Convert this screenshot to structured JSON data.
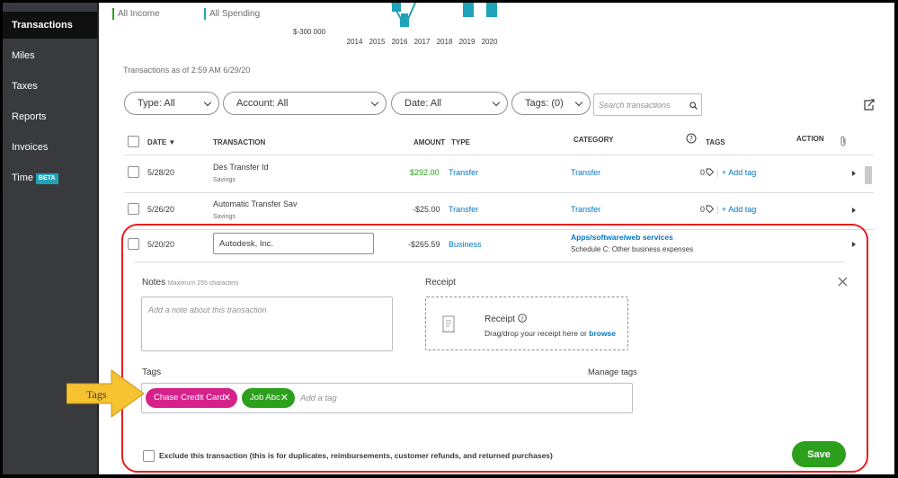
{
  "sidebar": {
    "items": [
      {
        "label": "Transactions"
      },
      {
        "label": "Miles"
      },
      {
        "label": "Taxes"
      },
      {
        "label": "Reports"
      },
      {
        "label": "Invoices"
      },
      {
        "label": "Time",
        "badge": "BETA"
      }
    ]
  },
  "chart": {
    "legend": [
      {
        "label": "All Income",
        "color": "#2ca01c"
      },
      {
        "label": "All Spending",
        "color": "#1fa3b8"
      }
    ],
    "y_tick": "$-300 000",
    "years": [
      "2014",
      "2015",
      "2016",
      "2017",
      "2018",
      "2019",
      "2020"
    ]
  },
  "as_of": "Transactions as of 2:59 AM 6/29/20",
  "filters": {
    "type": "Type: All",
    "account": "Account: All",
    "date": "Date: All",
    "tags": "Tags: (0)",
    "search_placeholder": "Search transactions"
  },
  "table": {
    "headers": {
      "date": "DATE ▼",
      "transaction": "TRANSACTION",
      "amount": "AMOUNT",
      "type": "TYPE",
      "category": "CATEGORY",
      "tags": "TAGS",
      "action": "ACTION"
    },
    "rows": [
      {
        "date": "5/28/20",
        "name": "Des Transfer Id",
        "account": "Savings",
        "amount": "$292.00",
        "type": "Transfer",
        "category": "Transfer",
        "tag_count": "0",
        "add_tag": "+ Add tag"
      },
      {
        "date": "5/26/20",
        "name": "Automatic Transfer Sav",
        "account": "Savings",
        "amount": "-$25.00",
        "type": "Transfer",
        "category": "Transfer",
        "tag_count": "0",
        "add_tag": "+ Add tag"
      }
    ],
    "expanded": {
      "date": "5/20/20",
      "name": "Autodesk, Inc.",
      "amount": "-$265.59",
      "type": "Business",
      "category": "Apps/software/web services",
      "category_sub": "Schedule C: Other business expenses"
    }
  },
  "detail": {
    "notes_label": "Notes",
    "notes_hint": "Maximum 255 characters",
    "notes_placeholder": "Add a note about this transaction",
    "receipt_label": "Receipt",
    "receipt_title": "Receipt",
    "receipt_drop_text": "Drag/drop your receipt here or",
    "receipt_browse": "browse",
    "tags_label": "Tags",
    "manage_tags": "Manage tags",
    "tags": [
      {
        "label": "Chase Credit Card",
        "color": "#d6218a"
      },
      {
        "label": "Job Abc",
        "color": "#2ca01c"
      }
    ],
    "add_tag_placeholder": "Add a tag",
    "exclude_label": "Exclude this transaction (this is for duplicates, reimbursements, customer refunds, and returned purchases)",
    "save": "Save"
  },
  "annotation": {
    "label": "Tags"
  }
}
